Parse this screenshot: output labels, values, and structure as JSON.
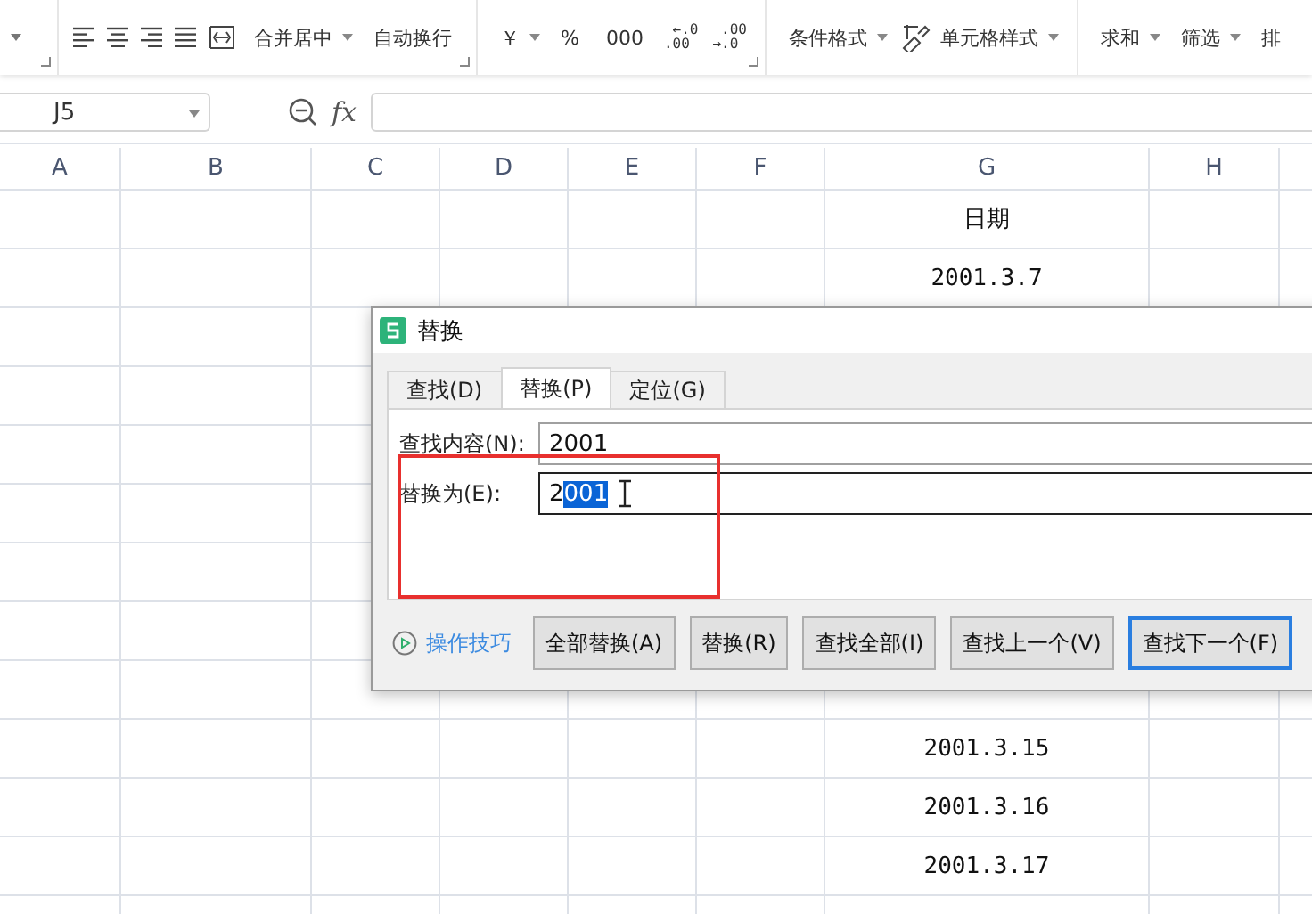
{
  "toolbar": {
    "groups": [
      {
        "kind": "align",
        "items": [
          {
            "kind": "align-left"
          },
          {
            "kind": "align-center"
          },
          {
            "kind": "align-right"
          },
          {
            "kind": "justify"
          },
          {
            "kind": "distribute"
          }
        ],
        "buttons": [
          {
            "label": "合并居中",
            "dropdown": true
          },
          {
            "label": "自动换行",
            "dropdown": false
          }
        ]
      },
      {
        "kind": "number",
        "buttons": [
          {
            "label": "￥",
            "dropdown": true
          },
          {
            "label": "%",
            "dropdown": false
          },
          {
            "label": "000",
            "dropdown": false
          },
          {
            "label": "←.0\n.00",
            "dropdown": false
          },
          {
            "label": ".00\n→.0",
            "dropdown": false
          }
        ]
      },
      {
        "kind": "style",
        "buttons": [
          {
            "label": "条件格式",
            "dropdown": true
          },
          {
            "label": "单元格样式",
            "dropdown": true,
            "icon": true
          }
        ]
      },
      {
        "kind": "edit",
        "buttons": [
          {
            "label": "求和",
            "dropdown": true
          },
          {
            "label": "筛选",
            "dropdown": true
          },
          {
            "label": "排",
            "dropdown": false
          }
        ]
      }
    ]
  },
  "formula_bar": {
    "cell_ref": "J5",
    "fx": "fx"
  },
  "sheet": {
    "columns": [
      "A",
      "B",
      "C",
      "D",
      "E",
      "F",
      "G",
      "H"
    ],
    "rows": [
      {
        "g": "日期"
      },
      {
        "g": "2001.3.7"
      },
      {},
      {},
      {},
      {},
      {},
      {},
      {},
      {
        "g": "2001.3.15"
      },
      {
        "g": "2001.3.16"
      },
      {
        "g": "2001.3.17"
      },
      {}
    ]
  },
  "dialog": {
    "title": "替换",
    "tabs": [
      {
        "label": "查找(D)",
        "selected": false
      },
      {
        "label": "替换(P)",
        "selected": true
      },
      {
        "label": "定位(G)",
        "selected": false
      }
    ],
    "fields": [
      {
        "label": "查找内容(N):",
        "parts": [
          {
            "text": "2001",
            "selected": false
          }
        ],
        "focused": false
      },
      {
        "label": "替换为(E):",
        "parts": [
          {
            "text": "2",
            "selected": false
          },
          {
            "text": "001",
            "selected": true
          }
        ],
        "focused": true
      }
    ],
    "tip_link": "操作技巧",
    "buttons": [
      {
        "label": "全部替换(A)",
        "default": false
      },
      {
        "label": "替换(R)",
        "default": false
      },
      {
        "label": "查找全部(I)",
        "default": false
      },
      {
        "label": "查找上一个(V)",
        "default": false
      },
      {
        "label": "查找下一个(F)",
        "default": true
      }
    ]
  }
}
